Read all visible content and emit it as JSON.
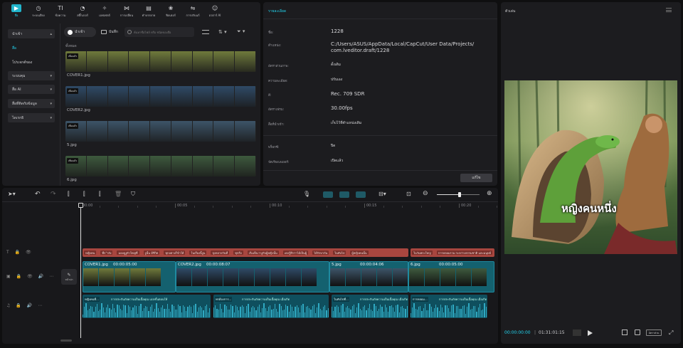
{
  "toolbar": [
    {
      "label": "สื่อ",
      "icon": "media-icon",
      "active": true
    },
    {
      "label": "ระบบเสียง",
      "icon": "audio-icon"
    },
    {
      "label": "ข้อความ",
      "icon": "text-icon"
    },
    {
      "label": "สติ๊กเกอร์",
      "icon": "sticker-icon"
    },
    {
      "label": "เอฟเฟกต์",
      "icon": "effects-icon"
    },
    {
      "label": "การเปลี่ยน",
      "icon": "transition-icon"
    },
    {
      "label": "คำบรรยาย",
      "icon": "captions-icon"
    },
    {
      "label": "ฟิลเตอร์",
      "icon": "filter-icon"
    },
    {
      "label": "การปรับแก้",
      "icon": "adjust-icon"
    },
    {
      "label": "อวตาร์ AI",
      "icon": "avatar-ai-icon"
    }
  ],
  "sidebar": [
    {
      "label": "นำเข้า",
      "expand": true
    },
    {
      "label": "สื่อ"
    },
    {
      "label": "โปรเจกต์ของ"
    },
    {
      "label": "ระบบคุม"
    },
    {
      "label": "สื่อ AI"
    },
    {
      "label": "สื่อที่ติดกับข้อมูล"
    },
    {
      "label": "ไดเรกธิ"
    }
  ],
  "media": {
    "import_label": "นำเข้า",
    "record_label": "บันทึก",
    "search_placeholder": "ค้นหาชื่อไฟล์ หรือ ชนิดของสื่อ",
    "section_label": "ทั้งหมด",
    "items": [
      {
        "name": "COVER1.jpg",
        "badge": "เพิ่มแล้ว",
        "color": "#6f7a3c"
      },
      {
        "name": "COVER2.jpg",
        "badge": "เพิ่มแล้ว",
        "color": "#2f4a66"
      },
      {
        "name": "5.jpg",
        "badge": "เพิ่มแล้ว",
        "color": "#3d5468"
      },
      {
        "name": "6.jpg",
        "badge": "เพิ่มแล้ว",
        "color": "#3e5a3e"
      }
    ]
  },
  "details": {
    "header": "รายละเอียด",
    "rows": [
      {
        "label": "ชื่อ:",
        "value": "1228",
        "big": true
      },
      {
        "label": "ตำแหน่ง:",
        "value": "C:/Users/ASUS/AppData/Local/CapCut/User Data/Projects/\ncom.lveditor.draft/1228",
        "big": true
      },
      {
        "label": "อัตราส่วนภาพ:",
        "value": "ดั้งเดิม",
        "big": false
      },
      {
        "label": "ความละเอียด:",
        "value": "ปรับเอง",
        "big": false
      },
      {
        "label": "สี:",
        "value": "Rec. 709 SDR",
        "big": true
      },
      {
        "label": "อัตราเฟรม:",
        "value": "30.00fps",
        "big": true
      },
      {
        "label": "สื่อที่นำเข้า:",
        "value": "เก็บไว้ที่ตำแหน่งเดิม",
        "big": false
      },
      {
        "label": "พร็อกซี:",
        "value": "ปิด",
        "big": false
      },
      {
        "label": "จัดเรียงเลเยอร์:",
        "value": "เปิดแล้ว",
        "big": false
      }
    ],
    "modify_button": "แก้ไข"
  },
  "player": {
    "title": "ตัวเล่น",
    "caption": "หญิงคนหนึ่ง",
    "time_current": "00:00:00:00",
    "time_total": "01:31:01:15",
    "ratio_label": "อัตราส่วน"
  },
  "timeline": {
    "ruler": [
      "00:00",
      "00:05",
      "00:10",
      "00:15",
      "00:20"
    ],
    "cover_label": "หน้าปก",
    "text_clips": [
      {
        "items": [
          "หญิงคน",
          "ที่ก ำลัง",
          "มองดูงูตัวใหญ่ที่",
          "งูนั้น มีชีวิต",
          "ทุกอย่างก็ข้าให้",
          "ในเรื่องนี้งูน",
          "บุ่งหลายวันที่",
          "ทุกสิ่ง",
          "เริ่มเห็นว่างูกับผู้หญิงนั้น",
          "เธอรู้สึกว่าได้เป็นผู้",
          "ได้รักษาถัน",
          "แสงนั้นเป็นเรื่องไม่",
          "ในทับไป",
          "ผู้หญิงคนนั้น",
          "ในวันพระใหญ่",
          "การหลอมรวม ระหว่างธรรมชาติ และมนุษย์"
        ]
      }
    ],
    "video_clips": [
      {
        "name": "COVER1.jpg",
        "duration": "00:00:05:00",
        "color": "#6f7a3c"
      },
      {
        "name": "COVER2.jpg",
        "duration": "00:00:08:07",
        "color": "#2f4a66"
      },
      {
        "name": "5.jpg",
        "duration": "00:00:04:06",
        "color": "#3d5468"
      },
      {
        "name": "6.jpg",
        "duration": "00:00:05:00",
        "color": "#3e5a3e"
      }
    ],
    "audio_clips": [
      {
        "title": "หญิงคนที่...",
        "text": "การประกันภัยความเป็นเนื้อคุณ แบ่งขั้นตอนให้"
      },
      {
        "title": "พรต้องการ...",
        "text": "การประกันภัยความเป็นเนื้อคุณ เมื่อเกิด"
      },
      {
        "title": "ในทับไปที่...",
        "text": "การประกันภัยความเป็นเนื้อคุณ เมื่อเกิด"
      },
      {
        "title": "การหลอม...",
        "text": "การประกันภัยความเป็นเนื้อคุณ เมื่อเกิด"
      }
    ]
  },
  "colors": {
    "accent": "#22d3ee",
    "text_clip": "#a8463f",
    "audio": "#0f4f5e"
  }
}
